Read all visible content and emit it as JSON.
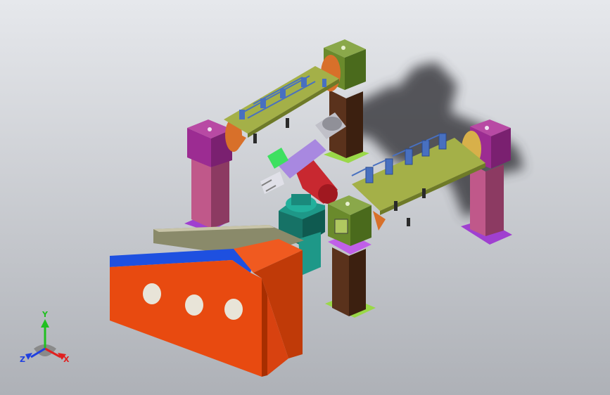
{
  "colors": {
    "bg_top": "#e6e8ec",
    "bg_bottom": "#aeb1b7",
    "shadow": "#3c3e42",
    "column_magenta": "#c0588a",
    "column_cap_purple": "#9c2c92",
    "column_brown": "#5a321c",
    "base_purple": "#a040d0",
    "base_lime": "#9ad848",
    "cap_olive": "#5a7a28",
    "disc_orange": "#d8702a",
    "plate_olive": "#a4b048",
    "clamp_blue": "#4870c0",
    "robot_teal": "#1e9888",
    "robot_red": "#c82830",
    "robot_lavender": "#a888e0",
    "robot_green": "#3ee060",
    "frame_orange": "#e84a10",
    "frame_blue": "#1e50e0",
    "frame_grey": "#8a8a6a"
  },
  "axes": {
    "x_label": "X",
    "y_label": "Y",
    "z_label": "Z",
    "x_color": "#e02020",
    "y_color": "#20c020",
    "z_color": "#2040e0"
  }
}
